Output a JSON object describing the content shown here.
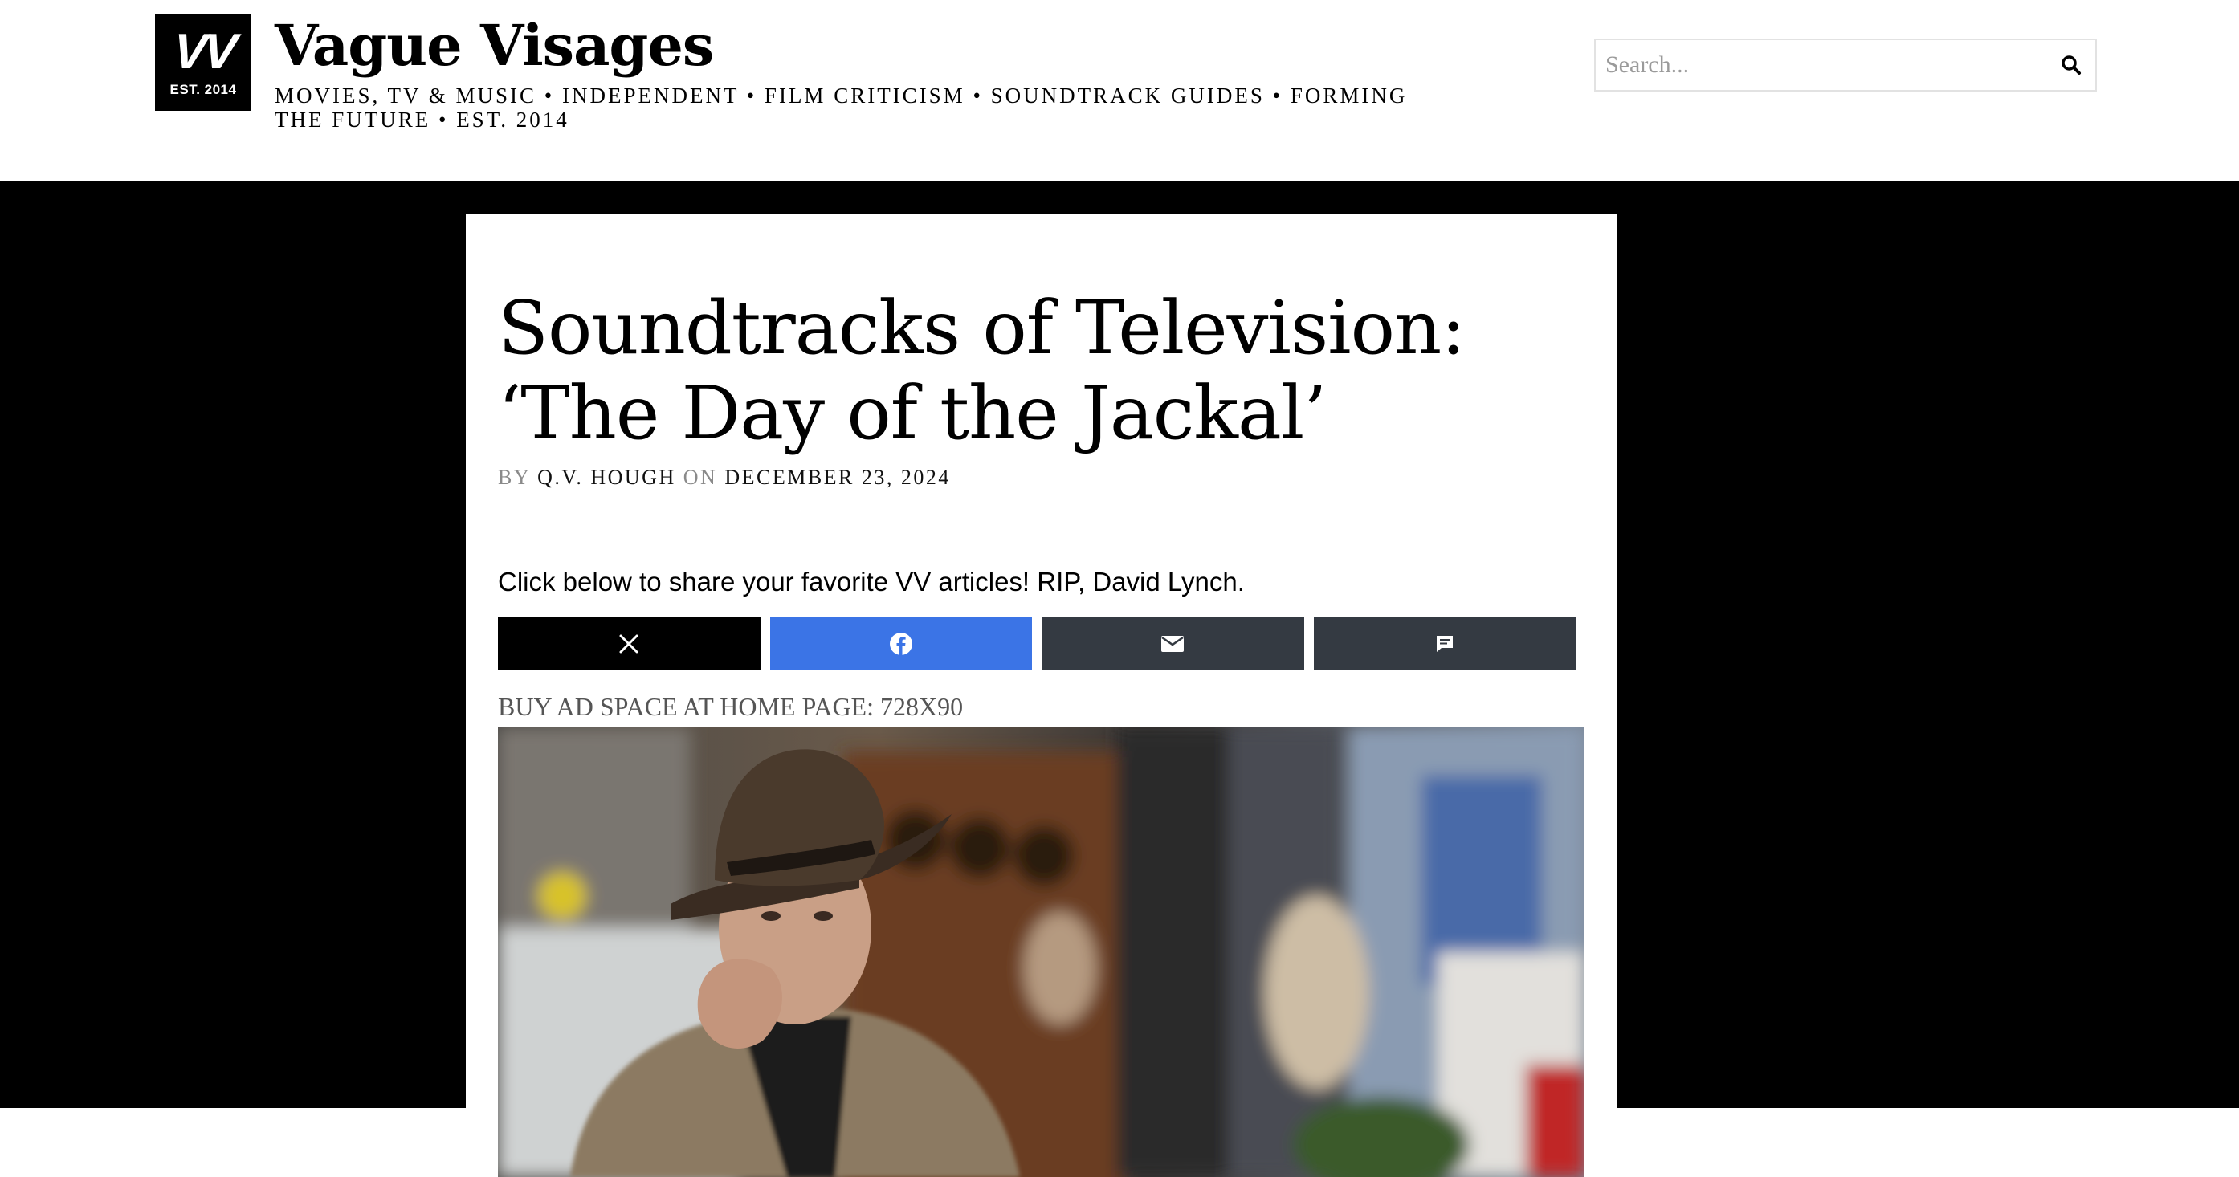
{
  "site": {
    "logo_mark": "VV",
    "logo_est": "EST. 2014",
    "title": "Vague Visages",
    "tagline": "MOVIES, TV & MUSIC • INDEPENDENT • FILM CRITICISM • SOUNDTRACK GUIDES • FORMING THE FUTURE • EST. 2014"
  },
  "search": {
    "placeholder": "Search...",
    "value": "",
    "icon": "search-icon"
  },
  "article": {
    "title": "Soundtracks of Television: ‘The Day of the Jackal’",
    "byline": {
      "by": "BY",
      "author": "Q.V. HOUGH",
      "on": "ON",
      "date": "DECEMBER 23, 2024"
    },
    "share_prompt": "Click below to share your favorite VV articles! RIP, David Lynch.",
    "share_buttons": [
      {
        "icon": "x-icon",
        "color": "#000000"
      },
      {
        "icon": "facebook-icon",
        "color": "#3b74e6"
      },
      {
        "icon": "email-icon",
        "color": "#343a42"
      },
      {
        "icon": "comment-icon",
        "color": "#343a42"
      }
    ],
    "ad_label": "BUY AD SPACE AT HOME PAGE: 728X90"
  },
  "colors": {
    "background_band": "#000000",
    "card": "#ffffff",
    "facebook_blue": "#3b74e6",
    "dark_button": "#343a42"
  }
}
